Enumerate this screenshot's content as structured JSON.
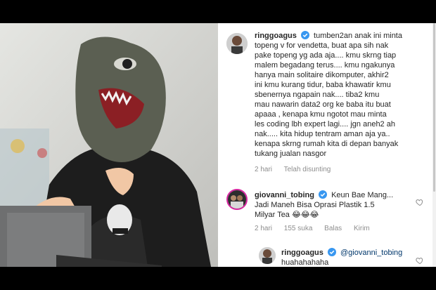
{
  "post": {
    "author": "ringgoagus",
    "caption_lines": [
      "tumben2an anak ini minta",
      "topeng v for vendetta, buat apa sih nak",
      "pake topeng yg ada aja.... kmu skrng tiap",
      "malem begadang terus.... kmu ngakunya",
      "hanya main solitaire dikomputer, akhir2",
      "ini kmu kurang tidur, baba khawatir kmu",
      "sbenernya ngapain nak.... tiba2 kmu",
      "mau nawarin data2 org ke baba itu buat",
      "apaaa , kenapa kmu ngotot mau minta",
      "les coding lbh expert lagi.... jgn aneh2 ah",
      "nak..... kita hidup tentram aman aja ya..",
      "kenapa skrng rumah kita di depan banyak",
      "tukang jualan nasgor"
    ],
    "meta": {
      "time": "2 hari",
      "edited": "Telah disunting"
    }
  },
  "comments": [
    {
      "author": "giovanni_tobing",
      "lines": [
        "Keun Bae Mang...",
        "Jadi Maneh Bisa Oprasi Plastik 1.5",
        "Milyar Tea 😂😂😂"
      ],
      "time": "2 hari",
      "likes": "155 suka",
      "reply": "Balas",
      "send": "Kirim"
    },
    {
      "author": "ringgoagus",
      "mention": "@giovanni_tobing",
      "lines": [
        "huahahahaha"
      ]
    }
  ],
  "colors": {
    "verified": "#3897f0",
    "text": "#262626",
    "meta": "#8e8e8e"
  }
}
